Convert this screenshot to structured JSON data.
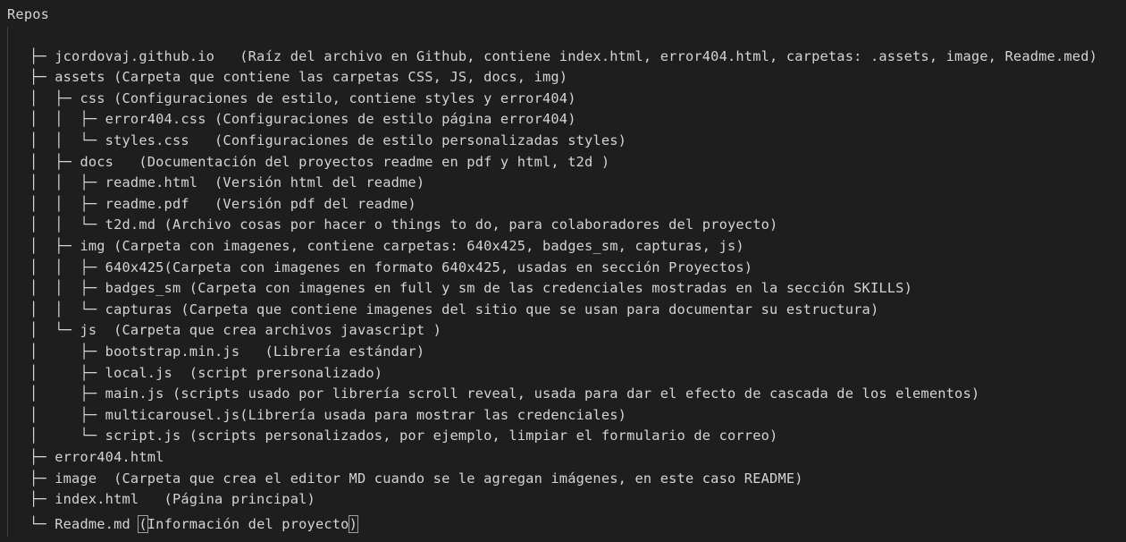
{
  "editor": {
    "title": "Repos",
    "lines": [
      "",
      "├─ jcordovaj.github.io   (Raíz del archivo en Github, contiene index.html, error404.html, carpetas: .assets, image, Readme.med)",
      "├─ assets (Carpeta que contiene las carpetas CSS, JS, docs, img)",
      "│  ├─ css (Configuraciones de estilo, contiene styles y error404)",
      "│  │  ├─ error404.css (Configuraciones de estilo página error404)",
      "│  │  └─ styles.css   (Configuraciones de estilo personalizadas styles)",
      "│  ├─ docs   (Documentación del proyectos readme en pdf y html, t2d )",
      "│  │  ├─ readme.html  (Versión html del readme)",
      "│  │  ├─ readme.pdf   (Versión pdf del readme)",
      "│  │  └─ t2d.md (Archivo cosas por hacer o things to do, para colaboradores del proyecto)",
      "│  ├─ img (Carpeta con imagenes, contiene carpetas: 640x425, badges_sm, capturas, js)",
      "│  │  ├─ 640x425(Carpeta con imagenes en formato 640x425, usadas en sección Proyectos)",
      "│  │  ├─ badges_sm (Carpeta con imagenes en full y sm de las credenciales mostradas en la sección SKILLS)",
      "│  │  └─ capturas (Carpeta que contiene imagenes del sitio que se usan para documentar su estructura)",
      "│  └─ js  (Carpeta que crea archivos javascript )",
      "│     ├─ bootstrap.min.js   (Librería estándar)",
      "│     ├─ local.js  (script prersonalizado)",
      "│     ├─ main.js (scripts usado por librería scroll reveal, usada para dar el efecto de cascada de los elementos)",
      "│     ├─ multicarousel.js(Librería usada para mostrar las credenciales)",
      "│     └─ script.js (scripts personalizados, por ejemplo, limpiar el formulario de correo)",
      "├─ error404.html",
      "├─ image  (Carpeta que crea el editor MD cuando se le agregan imágenes, en este caso README)",
      "├─ index.html   (Página principal)"
    ],
    "last_line": {
      "prefix": "└─ Readme.md ",
      "open_paren": "(",
      "middle": "Información del proyecto",
      "close_paren": ")"
    }
  }
}
